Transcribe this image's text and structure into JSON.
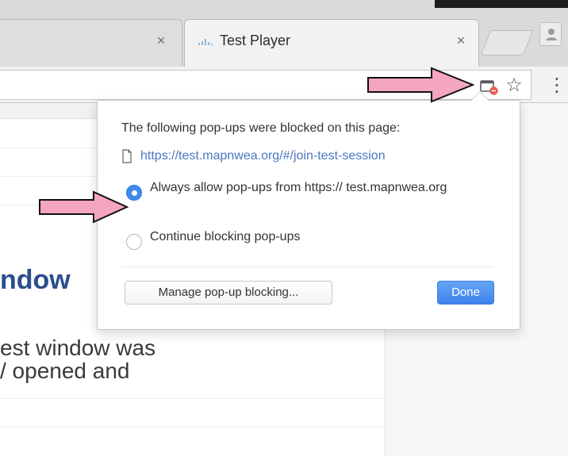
{
  "browser": {
    "tabs": [
      {
        "label": "",
        "close_symbol": "×",
        "active": false,
        "icon": "close-icon"
      },
      {
        "label": "Test Player",
        "close_symbol": "×",
        "active": true,
        "favicon": "test-player-favicon",
        "icon": "close-icon"
      }
    ],
    "toolbar": {
      "popup_blocked_icon": "popup-blocked-icon",
      "star_symbol": "☆",
      "menu_symbol": "⋮"
    }
  },
  "page": {
    "heading_fragment": "ndow",
    "body_lines": [
      "est window was",
      "/ opened and"
    ]
  },
  "popup_bubble": {
    "title": "The following pop-ups were blocked on this page:",
    "blocked_link": "https://test.mapnwea.org/#/join-test-session",
    "options": [
      {
        "label": "Always allow pop-ups from https:// test.mapnwea.org",
        "selected": true
      },
      {
        "label": "Continue blocking pop-ups",
        "selected": false
      }
    ],
    "manage_button": "Manage pop-up blocking...",
    "done_button": "Done"
  },
  "colors": {
    "arrow_fill": "#f4a5c0",
    "link_blue": "#4a78c2",
    "radio_blue": "#3f8ae9",
    "done_blue": "#3f83ea",
    "heading_blue": "#2b4d8d"
  }
}
